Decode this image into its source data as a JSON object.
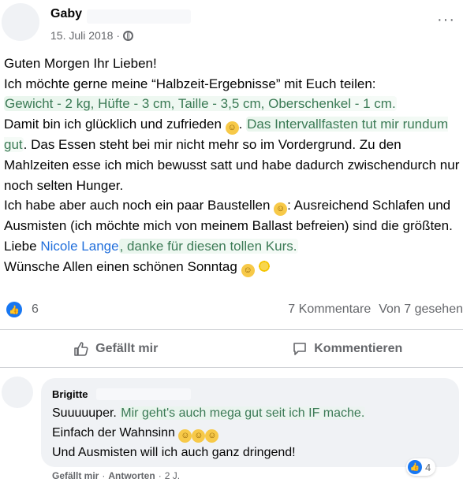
{
  "post": {
    "author": "Gaby",
    "date": "15. Juli 2018",
    "dot": "·",
    "more": "···",
    "lines": {
      "l1": "Guten Morgen Ihr Lieben!",
      "l2": "Ich möchte gerne meine “Halbzeit-Ergebnisse” mit Euch teilen:",
      "l3": "Gewicht - 2 kg, Hüfte - 3 cm, Taille - 3,5 cm, Oberschenkel - 1 cm.",
      "l4a": "Damit bin ich glücklich und zufrieden",
      "l4b": "Das Intervallfasten tut mir rundum gut",
      "l4c": ". Das Essen steht bei mir nicht mehr so im Vordergrund. Zu den Mahlzeiten esse ich mich bewusst satt und habe dadurch zwischendurch nur noch selten Hunger.",
      "l5a": "Ich habe aber auch noch ein paar Baustellen",
      "l5b": ": Ausreichend Schlafen und Ausmisten (ich möchte mich von meinem Ballast befreien) sind die größten.",
      "l6a": "Liebe ",
      "l6link": "Nicole Lange",
      "l6b": ", danke für diesen tollen Kurs.",
      "l7": "Wünsche Allen einen schönen Sonntag"
    }
  },
  "stats": {
    "likes": "6",
    "comments": "7 Kommentare",
    "views": "Von 7 gesehen"
  },
  "actions": {
    "like": "Gefällt mir",
    "comment": "Kommentieren"
  },
  "comment": {
    "author": "Brigitte",
    "lines": {
      "c1a": "Suuuuuper. ",
      "c1b": "Mir geht's auch mega gut seit ich IF mache.",
      "c2": "Einfach der Wahnsinn",
      "c3": "Und Ausmisten will ich auch ganz dringend!"
    },
    "reactions": "4",
    "like": "Gefällt mir",
    "reply": "Antworten",
    "time": "2 J.",
    "sep": "·"
  },
  "icons": {
    "like": "thumbs-up-icon",
    "comment": "speech-bubble-icon",
    "privacy": "globe-icon"
  },
  "colors": {
    "accent": "#1877f2",
    "link": "#216fdb",
    "highlight_text": "#3b7a55",
    "muted": "#65676b"
  }
}
